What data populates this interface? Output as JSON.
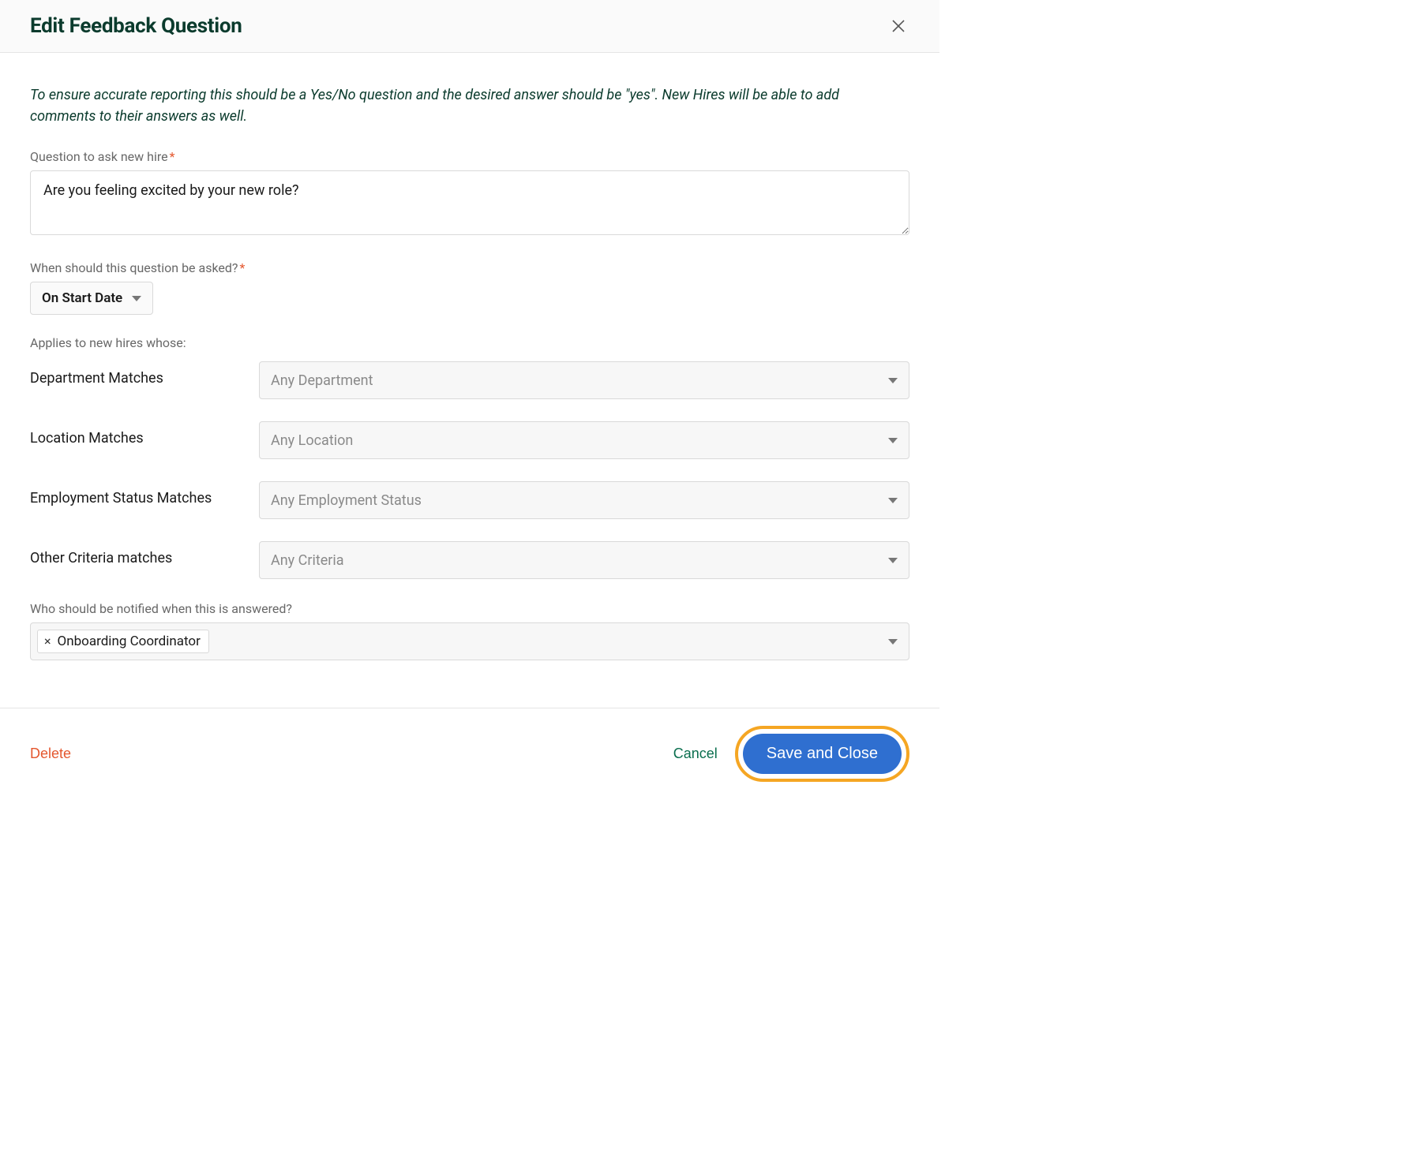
{
  "header": {
    "title": "Edit Feedback Question"
  },
  "intro": "To ensure accurate reporting this should be a Yes/No question and the desired answer should be \"yes\". New Hires will be able to add comments to their answers as well.",
  "question": {
    "label": "Question to ask new hire",
    "value": "Are you feeling excited by your new role?"
  },
  "when": {
    "label": "When should this question be asked?",
    "selected": "On Start Date"
  },
  "applies_label": "Applies to new hires whose:",
  "criteria": [
    {
      "label": "Department Matches",
      "placeholder": "Any Department"
    },
    {
      "label": "Location Matches",
      "placeholder": "Any Location"
    },
    {
      "label": "Employment Status Matches",
      "placeholder": "Any Employment Status"
    },
    {
      "label": "Other Criteria matches",
      "placeholder": "Any Criteria"
    }
  ],
  "notify": {
    "label": "Who should be notified when this is answered?",
    "chips": [
      "Onboarding Coordinator"
    ]
  },
  "footer": {
    "delete": "Delete",
    "cancel": "Cancel",
    "save": "Save and Close"
  }
}
